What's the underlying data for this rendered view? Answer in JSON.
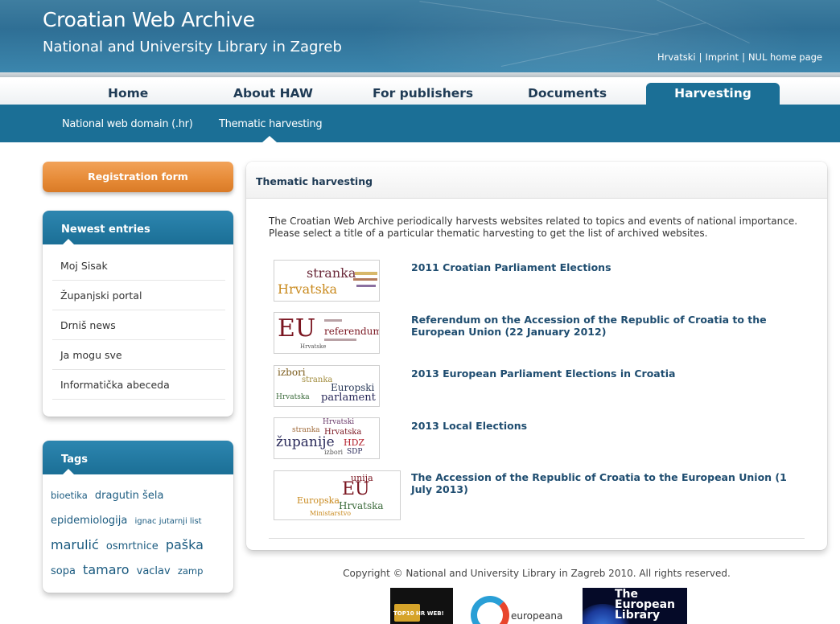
{
  "header": {
    "title": "Croatian Web Archive",
    "subtitle": "National and University Library in Zagreb",
    "links": [
      "Hrvatski",
      "Imprint",
      "NUL home page"
    ],
    "link_separator": "|"
  },
  "nav": {
    "items": [
      "Home",
      "About HAW",
      "For publishers",
      "Documents",
      "Harvesting"
    ],
    "active": "Harvesting"
  },
  "subnav": {
    "items": [
      "National web domain (.hr)",
      "Thematic harvesting"
    ],
    "active": "Thematic harvesting"
  },
  "sidebar": {
    "registration_label": "Registration form",
    "newest_title": "Newest entries",
    "newest_entries": [
      "Moj Sisak",
      "Županjski portal",
      "Drniš news",
      "Ja mogu sve",
      "Informatička abeceda"
    ],
    "tags_title": "Tags",
    "tags": [
      {
        "text": "bioetika",
        "size": "small"
      },
      {
        "text": "dragutin šela",
        "size": "medium"
      },
      {
        "text": "epidemiologija",
        "size": "medium"
      },
      {
        "text": "ignac jutarnji list",
        "size": "xsmall"
      },
      {
        "text": "marulić",
        "size": "large"
      },
      {
        "text": "osmrtnice",
        "size": "medium"
      },
      {
        "text": "paška",
        "size": "large"
      },
      {
        "text": "sopa",
        "size": "medium"
      },
      {
        "text": "tamaro",
        "size": "large"
      },
      {
        "text": "vaclav",
        "size": "medium"
      },
      {
        "text": "zamp",
        "size": "small"
      }
    ]
  },
  "content": {
    "heading": "Thematic harvesting",
    "intro": "The Croatian Web Archive periodically harvests websites related to topics and events of national importance. Please select a title of a particular thematic harvesting to get the list of archived websites.",
    "entries": [
      {
        "title": "2011 Croatian Parliament Elections",
        "cloud": [
          "stranka",
          "Hrvatska"
        ]
      },
      {
        "title": "Referendum on the Accession of the Republic of Croatia to the European Union (22 January 2012)",
        "cloud": [
          "EU",
          "referendum",
          "Hrvatske"
        ]
      },
      {
        "title": "2013 European Parliament Elections in Croatia",
        "cloud": [
          "izbori",
          "stranka",
          "Europski",
          "Hrvatska",
          "parlament"
        ]
      },
      {
        "title": "2013 Local Elections",
        "cloud": [
          "Hrvatski",
          "stranka",
          "Hrvatska",
          "županije",
          "HDZ",
          "izbori",
          "SDP"
        ]
      },
      {
        "title": "The Accession of the Republic of Croatia to the European Union (1 July 2013)",
        "cloud": [
          "unija",
          "EU",
          "Europska",
          "Hrvatska",
          "Ministarstvo"
        ]
      }
    ]
  },
  "footer": {
    "copyright": "Copyright © National and University Library in Zagreb 2010. All rights reserved.",
    "logos": [
      {
        "name": "top10",
        "text": "TOP10 HR WEB!"
      },
      {
        "name": "europeana",
        "text": "europeana"
      },
      {
        "name": "european-library",
        "text": "The European Library"
      }
    ]
  },
  "colors": {
    "header": "#2f6f95",
    "nav_active": "#1b6f96",
    "accent_orange": "#e68a36",
    "link": "#1f4d70"
  }
}
